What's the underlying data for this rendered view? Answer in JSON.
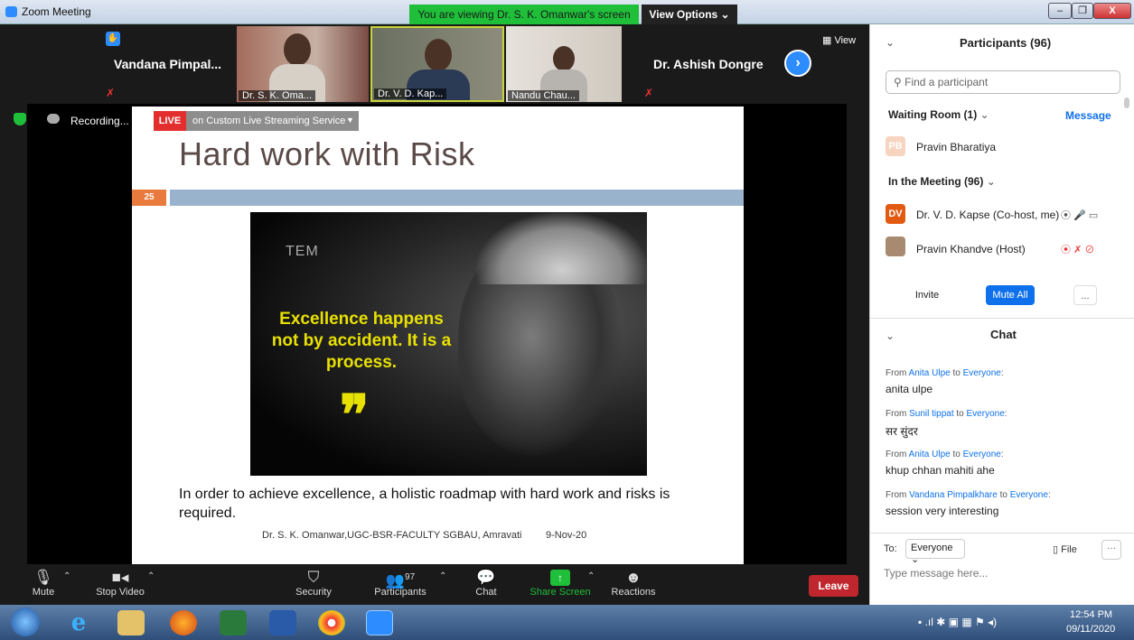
{
  "window": {
    "title": "Zoom Meeting",
    "viewing_banner": "You are viewing Dr. S. K. Omanwar's screen",
    "view_options": "View Options ⌄",
    "minimize": "–",
    "restore": "❐",
    "close": "X"
  },
  "video_strip": {
    "tiles": [
      {
        "name": "Vandana Pimpal...",
        "type": "name-only"
      },
      {
        "name": "Dr. S. K. Oma...",
        "type": "video"
      },
      {
        "name": "Dr. V. D. Kap...",
        "type": "video"
      },
      {
        "name": "Nandu Chau...",
        "type": "video"
      },
      {
        "name": "Dr. Ashish Dongre",
        "type": "name-only"
      }
    ],
    "view_label": "View"
  },
  "recording": {
    "label": "Recording..."
  },
  "live": {
    "tag": "LIVE",
    "text": "on Custom Live Streaming Service"
  },
  "slide": {
    "title": "Hard work with Risk",
    "number": "25",
    "image_brand": "TEM",
    "quote": "Excellence happens not by accident. It is a process.",
    "quote_mark": "❞",
    "body": "In order to achieve excellence, a holistic roadmap with hard work and risks is required.",
    "footer": "Dr. S. K. Omanwar,UGC-BSR-FACULTY SGBAU, Amravati",
    "date": "9-Nov-20"
  },
  "toolbar": {
    "mute": "Mute",
    "stop_video": "Stop Video",
    "security": "Security",
    "participants": "Participants",
    "participants_count": "97",
    "chat": "Chat",
    "share_screen": "Share Screen",
    "reactions": "Reactions",
    "leave": "Leave"
  },
  "panel": {
    "title": "Participants (96)",
    "search_placeholder": "Find a participant",
    "waiting_room": "Waiting Room (1)",
    "message_link": "Message",
    "waiting": [
      {
        "initials": "PB",
        "name": "Pravin Bharatiya"
      }
    ],
    "in_meeting": "In the Meeting (96)",
    "participants": [
      {
        "initials": "DV",
        "name": "Dr. V. D. Kapse (Co-host, me)"
      },
      {
        "initials": "",
        "name": "Pravin Khandve (Host)"
      }
    ],
    "invite": "Invite",
    "mute_all": "Mute All",
    "more": "..."
  },
  "chat": {
    "title": "Chat",
    "messages": [
      {
        "from": "Anita Ulpe",
        "to": "Everyone",
        "text": "anita ulpe"
      },
      {
        "from": "Sunil tippat",
        "to": "Everyone",
        "text": "सर सुंदर"
      },
      {
        "from": "Anita Ulpe",
        "to": "Everyone",
        "text": "khup chhan mahiti ahe"
      },
      {
        "from": "Vandana Pimpalkhare",
        "to": "Everyone",
        "text": "session very interesting"
      }
    ],
    "from_word": "From",
    "to_word": "to",
    "to_label": "To:",
    "to_value": "Everyone ⌄",
    "file": "File",
    "more": "···",
    "placeholder": "Type message here..."
  },
  "taskbar": {
    "time": "12:54 PM",
    "date": "09/11/2020"
  }
}
